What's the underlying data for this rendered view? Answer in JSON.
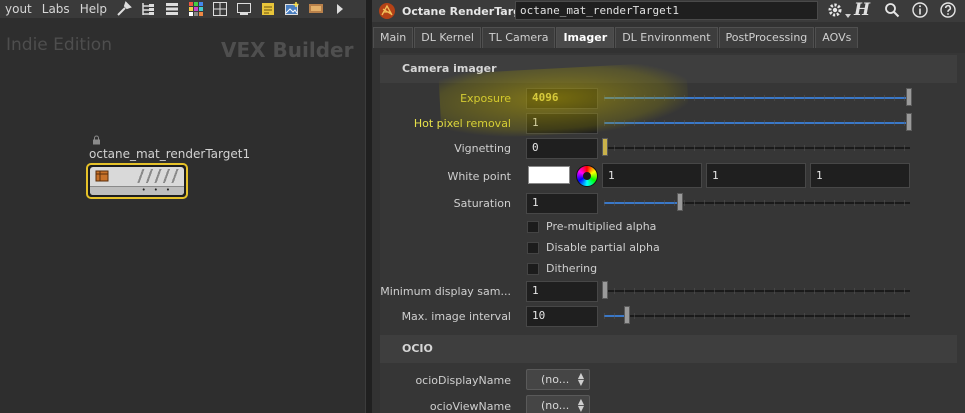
{
  "menubar": {
    "items": [
      "yout",
      "Labs",
      "Help"
    ]
  },
  "network": {
    "edition_label": "Indie Edition",
    "context_label": "VEX Builder",
    "node_label": "octane_mat_renderTarget1"
  },
  "header": {
    "node_type": "Octane RenderTarget",
    "node_name": "octane_mat_renderTarget1",
    "help_icon_letter": "H"
  },
  "tabs": [
    {
      "label": "Main"
    },
    {
      "label": "DL Kernel"
    },
    {
      "label": "TL Camera"
    },
    {
      "label": "Imager",
      "active": true
    },
    {
      "label": "DL Environment"
    },
    {
      "label": "PostProcessing"
    },
    {
      "label": "AOVs"
    }
  ],
  "sections": {
    "camera_imager": "Camera imager",
    "ocio": "OCIO"
  },
  "params": {
    "exposure": {
      "label": "Exposure",
      "value": "4096",
      "slider_fraction": 1.0
    },
    "hot_pixel_removal": {
      "label": "Hot pixel removal",
      "value": "1",
      "slider_fraction": 1.0
    },
    "vignetting": {
      "label": "Vignetting",
      "value": "0",
      "slider_fraction": 0.0
    },
    "white_point": {
      "label": "White point",
      "values": [
        "1",
        "1",
        "1"
      ]
    },
    "saturation": {
      "label": "Saturation",
      "value": "1",
      "slider_fraction": 0.25
    },
    "premultiplied_alpha": {
      "label": "Pre-multiplied alpha",
      "checked": false
    },
    "disable_partial_alpha": {
      "label": "Disable partial alpha",
      "checked": false
    },
    "dithering": {
      "label": "Dithering",
      "checked": false
    },
    "min_display_samples": {
      "label": "Minimum display sam...",
      "value": "1",
      "slider_fraction": 0.0
    },
    "max_image_interval": {
      "label": "Max. image interval",
      "value": "10",
      "slider_fraction": 0.07
    },
    "ocio_display_name": {
      "label": "ocioDisplayName",
      "value": "(no..."
    },
    "ocio_view_name": {
      "label": "ocioViewName",
      "value": "(no..."
    }
  },
  "colors": {
    "highlight_label": "#e7e14a",
    "node_border": "#e6c229",
    "slider_fill": "#3a78c8"
  }
}
